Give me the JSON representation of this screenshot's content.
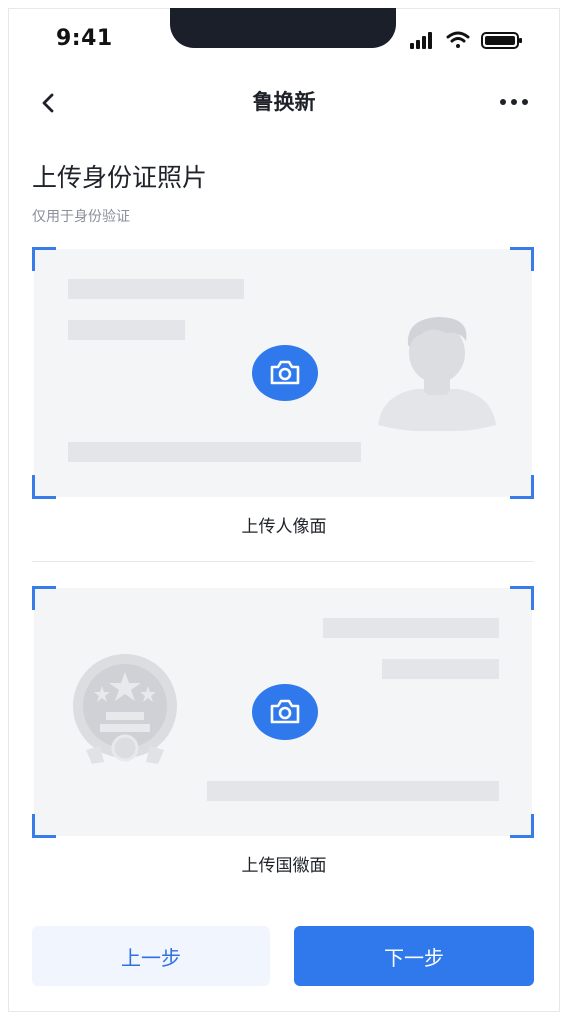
{
  "status_bar": {
    "time": "9:41"
  },
  "nav": {
    "title": "鲁换新"
  },
  "header": {
    "title": "上传身份证照片",
    "subtitle": "仅用于身份验证"
  },
  "cards": {
    "portrait": {
      "label": "上传人像面",
      "icon": "camera-icon"
    },
    "emblem": {
      "label": "上传国徽面",
      "icon": "camera-icon"
    }
  },
  "buttons": {
    "prev": "上一步",
    "next": "下一步"
  },
  "colors": {
    "accent": "#2f79ec",
    "corner": "#3a7bea",
    "placeholder": "#f4f5f7"
  }
}
